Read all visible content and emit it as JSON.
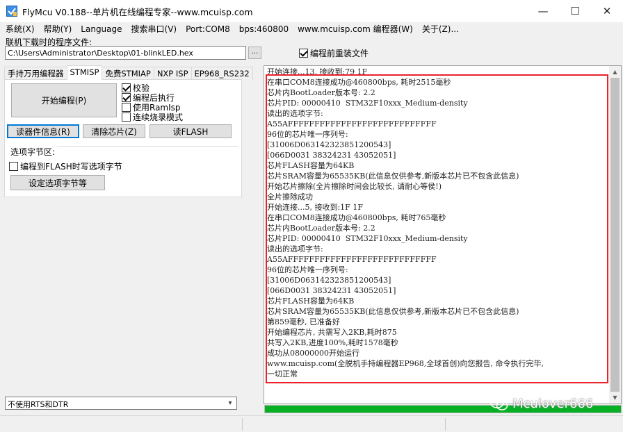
{
  "window": {
    "title": "FlyMcu V0.188--单片机在线编程专家--www.mcuisp.com",
    "minimize_glyph": "—",
    "maximize_glyph": "☐",
    "close_glyph": "✕"
  },
  "menu": [
    "系统(X)",
    "帮助(Y)",
    "Language",
    "搜索串口(V)",
    "Port:COM8",
    "bps:460800",
    "www.mcuisp.com 编程器(W)",
    "关于(Z)..."
  ],
  "file": {
    "label": "联机下载时的程序文件:",
    "path": "C:\\Users\\Administrator\\Desktop\\01-blinkLED.hex",
    "browse_label": "...",
    "reload_label": "编程前重装文件",
    "reload_checked": true
  },
  "tabs": [
    "手持万用编程器",
    "STMISP",
    "免费STMIAP",
    "NXP ISP",
    "EP968_RS232"
  ],
  "active_tab": "STMISP",
  "stmisp": {
    "start_button": "开始编程(P)",
    "options": [
      {
        "label": "校验",
        "checked": true
      },
      {
        "label": "编程后执行",
        "checked": true
      },
      {
        "label": "使用RamIsp",
        "checked": false
      },
      {
        "label": "连续烧录模式",
        "checked": false
      }
    ],
    "read_info_button": "读器件信息(R)",
    "erase_button": "清除芯片(Z)",
    "read_flash_button": "读FLASH",
    "option_group_title": "选项字节区:",
    "write_option_label": "编程到FLASH时写选项字节",
    "write_option_checked": false,
    "set_option_button": "设定选项字节等"
  },
  "rts_select": {
    "value": "不使用RTS和DTR",
    "arrow": "▾"
  },
  "log_lines": [
    "开始连接...13, 接收到:79 1F",
    "在串口COM8连接成功@460800bps, 耗时2515毫秒",
    "芯片内BootLoader版本号: 2.2",
    "芯片PID: 00000410  STM32F10xxx_Medium-density",
    "读出的选项字节:",
    "A55AFFFFFFFFFFFFFFFFFFFFFFFFFFFF",
    "96位的芯片唯一序列号:",
    "[31006D063142323851200543]",
    "[066D0031 38324231 43052051]",
    "芯片FLASH容量为64KB",
    "芯片SRAM容量为65535KB(此信息仅供参考,新版本芯片已不包含此信息)",
    "开始芯片擦除(全片擦除时间会比较长, 请耐心等侯!)",
    "全片擦除成功",
    "开始连接...5, 接收到:1F 1F",
    "在串口COM8连接成功@460800bps, 耗时765毫秒",
    "芯片内BootLoader版本号: 2.2",
    "芯片PID: 00000410  STM32F10xxx_Medium-density",
    "读出的选项字节:",
    "A55AFFFFFFFFFFFFFFFFFFFFFFFFFFFF",
    "96位的芯片唯一序列号:",
    "[31006D063142323851200543]",
    "[066D0031 38324231 43052051]",
    "芯片FLASH容量为64KB",
    "芯片SRAM容量为65535KB(此信息仅供参考,新版本芯片已不包含此信息)",
    "第859毫秒, 已准备好",
    "开始编程芯片, 共需写入2KB,耗时875",
    "共写入2KB,进度100%,耗时1578毫秒",
    "成功从08000000开始运行",
    "www.mcuisp.com(全脱机手持编程器EP968,全球首创)向您报告, 命令执行完毕,",
    "一切正常"
  ],
  "progress_percent": 100,
  "colors": {
    "highlight": "#e8232a",
    "progress": "#06b025",
    "focus": "#0078d7"
  },
  "watermark": {
    "text": "Mculover666",
    "icon": "wechat-icon"
  }
}
